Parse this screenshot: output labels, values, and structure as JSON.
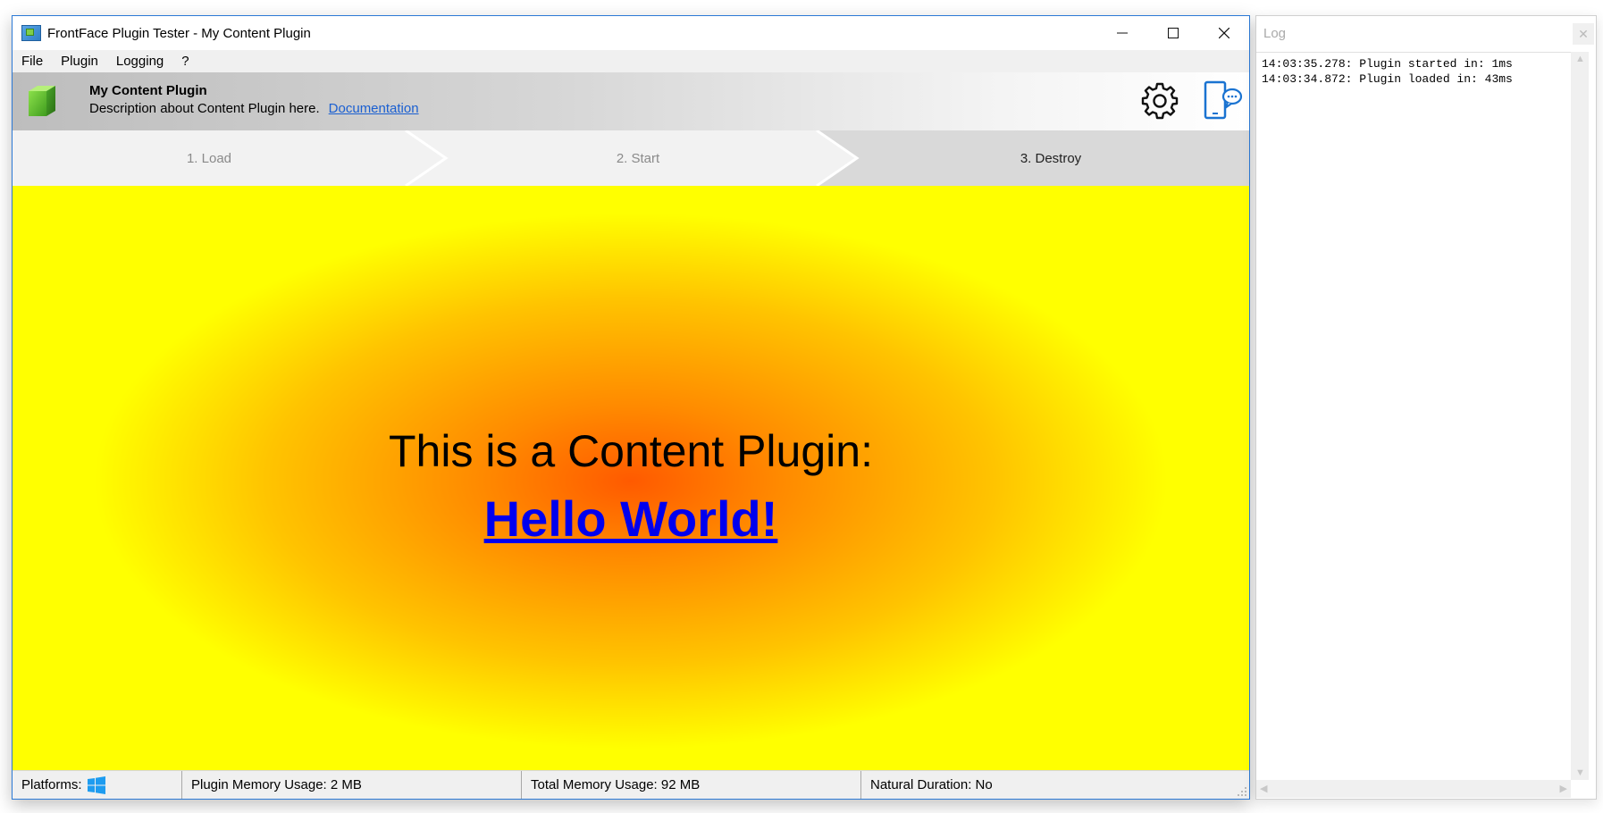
{
  "window": {
    "title": "FrontFace Plugin Tester - My Content Plugin",
    "controls": {
      "minimize": "—",
      "maximize": "☐",
      "close": "✕"
    }
  },
  "menu": [
    "File",
    "Plugin",
    "Logging",
    "?"
  ],
  "plugin": {
    "name": "My Content Plugin",
    "description": "Description about Content Plugin here.",
    "doc_link": "Documentation"
  },
  "steps": [
    "1. Load",
    "2. Start",
    "3. Destroy"
  ],
  "active_step": 3,
  "content": {
    "line1": "This is a Content Plugin:",
    "line2": "Hello World!"
  },
  "status": {
    "platforms_label": "Platforms:",
    "platform_icon": "windows-icon",
    "plugin_memory": "Plugin Memory Usage: 2 MB",
    "total_memory": "Total Memory Usage: 92 MB",
    "natural_duration": "Natural Duration: No"
  },
  "log": {
    "title": "Log",
    "close": "✕",
    "lines": [
      "14:03:35.278: Plugin started in: 1ms",
      "14:03:34.872: Plugin loaded in: 43ms"
    ]
  },
  "colors": {
    "accent": "#2b79d6",
    "content_outer": "#ffff00",
    "content_center": "#ff5a00",
    "link": "#0000ee",
    "doc_link": "#1a5fd1"
  },
  "icons": [
    "app-icon",
    "cube-icon",
    "gear-icon",
    "device-chat-icon",
    "windows-icon",
    "resize-grip-icon"
  ]
}
